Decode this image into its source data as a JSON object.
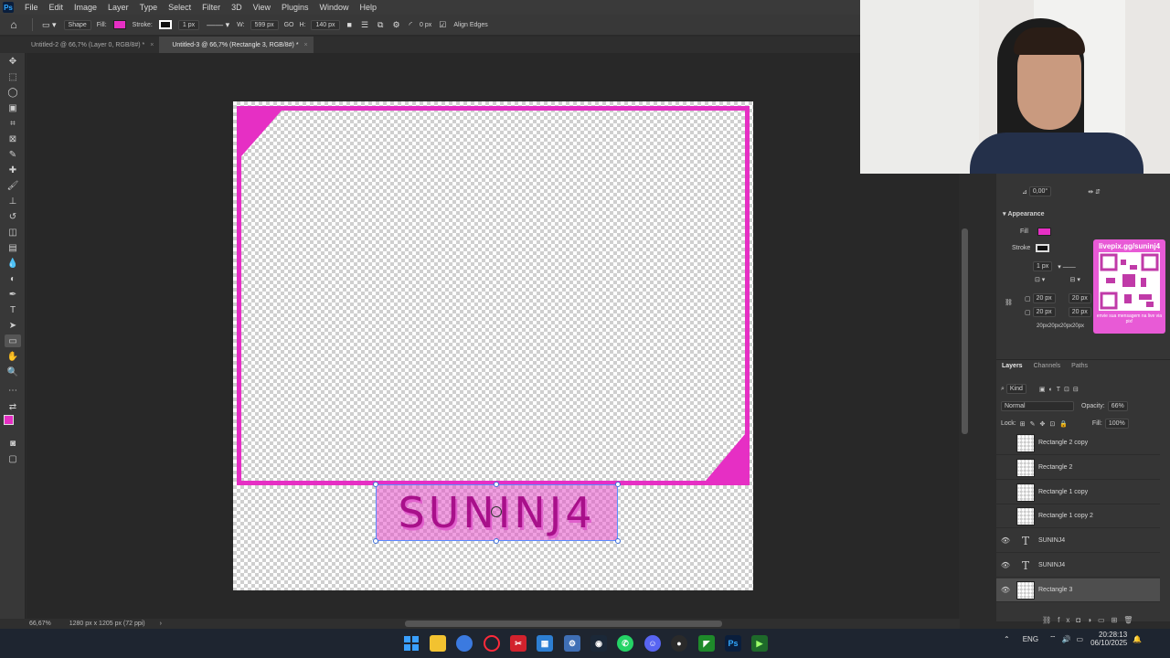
{
  "menu": [
    "File",
    "Edit",
    "Image",
    "Layer",
    "Type",
    "Select",
    "Filter",
    "3D",
    "View",
    "Plugins",
    "Window",
    "Help"
  ],
  "options": {
    "mode": "Shape",
    "fill_label": "Fill:",
    "stroke_label": "Stroke:",
    "stroke_width": "1 px",
    "w_label": "W:",
    "w_value": "599 px",
    "link": "GO",
    "h_label": "H:",
    "h_value": "140 px",
    "radius": "0 px",
    "align_edges": "Align Edges",
    "fill_color": "#e62fc4"
  },
  "tabs": [
    {
      "label": "Untitled-2 @ 66,7% (Layer 0, RGB/8#) *"
    },
    {
      "label": "Untitled-3 @ 66,7% (Rectangle 3, RGB/8#) *"
    }
  ],
  "canvas": {
    "frame_color": "#e62fc4",
    "nameplate_text": "SUNINJ4"
  },
  "properties": {
    "angle": "0,00°",
    "appearance": "Appearance",
    "fill": "Fill",
    "stroke": "Stroke",
    "stroke_width": "1 px",
    "corner1": "20 px",
    "corner2": "20 px",
    "corner3": "20 px",
    "corner4": "20 px",
    "corners_summary": "20px20px20px20px"
  },
  "qr_overlay": {
    "url": "livepix.gg/suninj4",
    "caption": "envie sua mensagem na live via pix!"
  },
  "layers_panel": {
    "tabs": [
      "Layers",
      "Channels",
      "Paths"
    ],
    "kind": "Kind",
    "blend": "Normal",
    "opacity_label": "Opacity:",
    "opacity": "66%",
    "lock_label": "Lock:",
    "fill_label": "Fill:",
    "fill": "100%",
    "layers": [
      {
        "name": "Rectangle 2 copy",
        "type": "shape",
        "visible": false
      },
      {
        "name": "Rectangle 2",
        "type": "shape",
        "visible": false
      },
      {
        "name": "Rectangle 1 copy",
        "type": "shape",
        "visible": false
      },
      {
        "name": "Rectangle 1 copy 2",
        "type": "shape",
        "visible": false
      },
      {
        "name": "SUNINJ4",
        "type": "text",
        "visible": true
      },
      {
        "name": "SUNINJ4",
        "type": "text",
        "visible": true
      },
      {
        "name": "Rectangle 3",
        "type": "shape",
        "visible": true,
        "selected": true
      }
    ]
  },
  "status": {
    "zoom": "66,67%",
    "doc_size": "1280 px x 1205 px (72 ppi)"
  },
  "taskbar": {
    "lang": "ENG",
    "time": "20:28:13",
    "date": "06/10/2025"
  }
}
